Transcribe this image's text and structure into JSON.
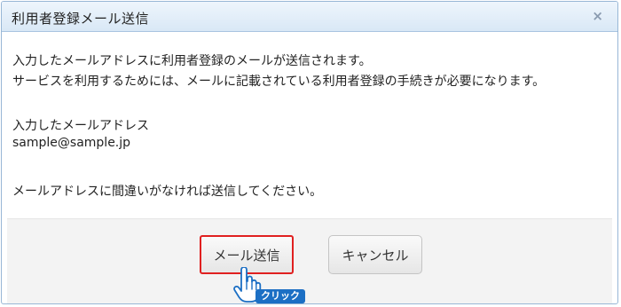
{
  "dialog": {
    "title": "利用者登録メール送信",
    "close_label": "×"
  },
  "message": {
    "line1": "入力したメールアドレスに利用者登録のメールが送信されます。",
    "line2": "サービスを利用するためには、メールに記載されている利用者登録の手続きが必要になります。",
    "address_label": "入力したメールアドレス",
    "address_value": "sample@sample.jp",
    "confirm": "メールアドレスに間違いがなければ送信してください。"
  },
  "buttons": {
    "send": "メール送信",
    "cancel": "キャンセル"
  },
  "annotation": {
    "click_badge": "クリック",
    "highlight_color": "#e02020",
    "badge_color": "#1c6fc4"
  }
}
